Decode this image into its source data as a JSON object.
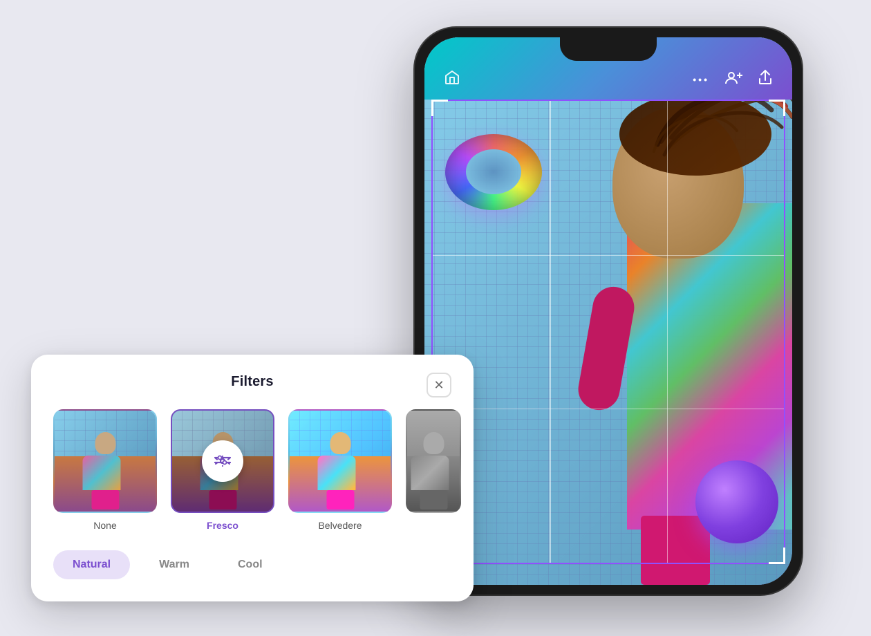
{
  "background_color": "#e8e8f0",
  "phone": {
    "topbar": {
      "home_icon": "⌂",
      "more_icon": "•••",
      "add_friend_icon": "👥",
      "share_icon": "↑"
    }
  },
  "filter_panel": {
    "title": "Filters",
    "close_label": "×",
    "thumbnails": [
      {
        "id": "none",
        "label": "None",
        "selected": false
      },
      {
        "id": "fresco",
        "label": "Fresco",
        "selected": true
      },
      {
        "id": "belvedere",
        "label": "Belvedere",
        "selected": false
      },
      {
        "id": "fourth",
        "label": "",
        "selected": false
      }
    ],
    "tones": [
      {
        "id": "natural",
        "label": "Natural",
        "active": true
      },
      {
        "id": "warm",
        "label": "Warm",
        "active": false
      },
      {
        "id": "cool",
        "label": "Cool",
        "active": false
      }
    ]
  }
}
